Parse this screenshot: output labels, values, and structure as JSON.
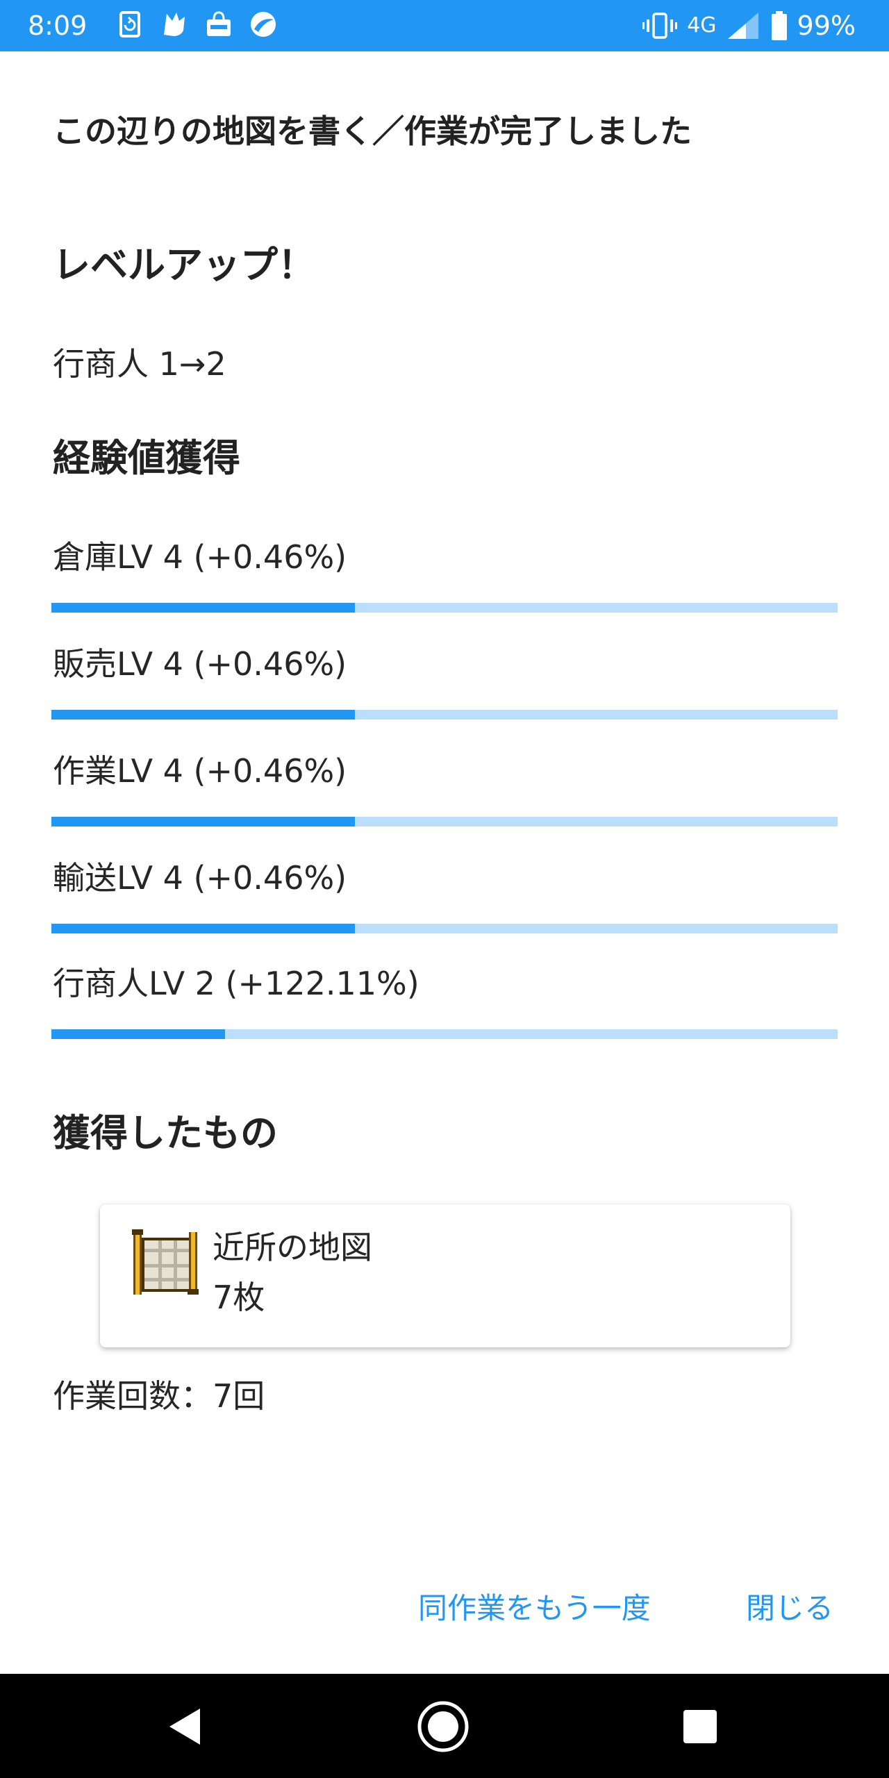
{
  "status_bar": {
    "time": "8:09",
    "network": "4G",
    "battery": "99%",
    "icons": [
      "sync-icon",
      "bird-app-icon",
      "mercari-bag-icon",
      "swirl-app-icon",
      "vibrate-icon",
      "signal-icon",
      "battery-icon"
    ],
    "background_color": "#2196f3"
  },
  "header": {
    "title": "この辺りの地図を書く／作業が完了しました"
  },
  "level_up": {
    "heading": "レベルアップ！",
    "detail": "行商人 1→2"
  },
  "experience": {
    "heading": "経験値獲得",
    "items": [
      {
        "label": "倉庫LV 4 (+0.46%)",
        "progress": 0.386
      },
      {
        "label": "販売LV 4 (+0.46%)",
        "progress": 0.386
      },
      {
        "label": "作業LV 4 (+0.46%)",
        "progress": 0.386
      },
      {
        "label": "輸送LV 4 (+0.46%)",
        "progress": 0.386
      },
      {
        "label": "行商人LV 2 (+122.11%)",
        "progress": 0.221
      }
    ],
    "bar_color": "#2196f3",
    "track_color": "#bbdefb"
  },
  "acquired": {
    "heading": "獲得したもの",
    "item": {
      "name": "近所の地図",
      "count": "7枚",
      "icon": "map-scroll-icon"
    }
  },
  "work_count": "作業回数：7回",
  "actions": {
    "repeat_label": "同作業をもう一度",
    "close_label": "閉じる",
    "link_color": "#2196f3"
  },
  "nav_bar": {
    "buttons": [
      "back-icon",
      "home-icon",
      "recents-icon"
    ]
  }
}
